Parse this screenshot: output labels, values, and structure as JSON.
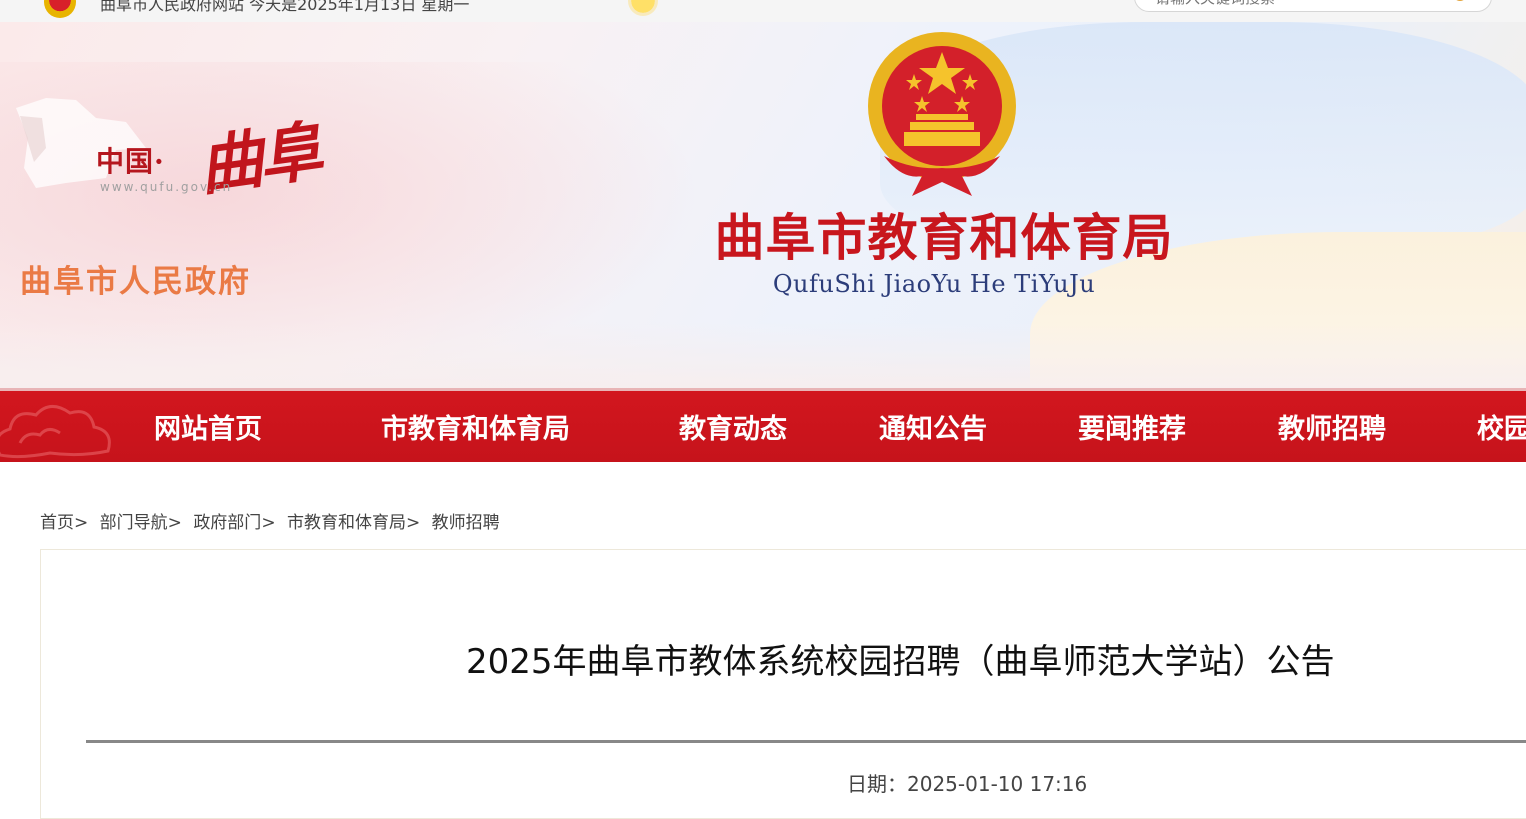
{
  "topbar": {
    "text": "曲阜市人民政府网站 今天是2025年1月13日 星期一",
    "search_placeholder": "请输入关键词搜索"
  },
  "banner": {
    "site_logo": {
      "china": "中国·",
      "qufu": "曲阜",
      "url": "www.qufu.gov.cn",
      "gov_name": "曲阜市人民政府"
    },
    "bureau_name": "曲阜市教育和体育局",
    "bureau_pinyin": "QufuShi JiaoYu He TiYuJu"
  },
  "nav": {
    "items": [
      {
        "label": "网站首页"
      },
      {
        "label": "市教育和体育局"
      },
      {
        "label": "教育动态"
      },
      {
        "label": "通知公告"
      },
      {
        "label": "要闻推荐"
      },
      {
        "label": "教师招聘"
      },
      {
        "label": "校园"
      }
    ]
  },
  "breadcrumb": {
    "items": [
      "首页",
      "部门导航",
      "政府部门",
      "市教育和体育局",
      "教师招聘"
    ],
    "separator": ">"
  },
  "article": {
    "title": "2025年曲阜市教体系统校园招聘（曲阜师范大学站）公告",
    "date_label": "日期：",
    "date_value": "2025-01-10 17:16"
  },
  "colors": {
    "nav_red": "#c8161d",
    "title_red": "#c8161d",
    "pinyin_blue": "#2c3d7a",
    "gov_orange": "#ea7a45"
  }
}
